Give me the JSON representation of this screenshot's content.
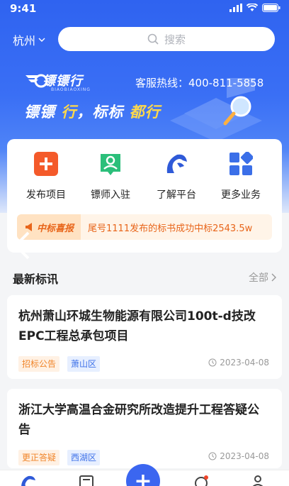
{
  "status_bar": {
    "time": "9:41"
  },
  "header": {
    "city": "杭州",
    "search_placeholder": "搜索"
  },
  "banner": {
    "brand_name": "镖镖行",
    "brand_pinyin": "BIAOBIAOXING",
    "hotline": "客服热线：400-811-5858",
    "slogan_prefix": "镖镖 ",
    "slogan_hl1": "行",
    "slogan_mid": "，标标 ",
    "slogan_hl2": "都行"
  },
  "quick_actions": [
    {
      "label": "发布项目",
      "icon": "plus-icon",
      "color": "#f45a2a"
    },
    {
      "label": "镖师入驻",
      "icon": "person-badge-icon",
      "color": "#2bbf7a"
    },
    {
      "label": "了解平台",
      "icon": "horse-logo-icon",
      "color": "#2f5ad8"
    },
    {
      "label": "更多业务",
      "icon": "grid-icon",
      "color": "#3b6fe8"
    }
  ],
  "notice": {
    "tag": "中标喜报",
    "text": "尾号1111发布的标书成功中标2543.5w"
  },
  "section": {
    "title": "最新标讯",
    "more": "全部"
  },
  "tenders": [
    {
      "title": "杭州萧山环城生物能源有限公司100t-d技改EPC工程总承包项目",
      "type": "招标公告",
      "region": "萧山区",
      "date": "2023-04-08"
    },
    {
      "title": "浙江大学高温合金研究所改造提升工程答疑公告",
      "type": "更正答疑",
      "region": "西湖区",
      "date": "2023-04-08"
    }
  ],
  "tabbar": {
    "add": "+"
  },
  "colors": {
    "primary": "#3b66f0",
    "accent_orange": "#e8651a",
    "slogan_yellow": "#ffd94a"
  }
}
